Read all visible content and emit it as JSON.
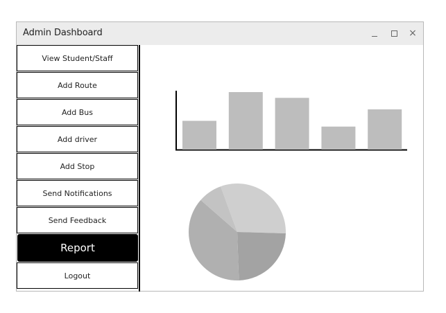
{
  "window": {
    "title": "Admin Dashboard",
    "controls": {
      "minimize_icon": "minimize-icon",
      "maximize_icon": "maximize-icon",
      "close_icon": "close-icon",
      "close_glyph": "×"
    }
  },
  "sidebar": {
    "items": [
      {
        "label": "View Student/Staff",
        "active": false
      },
      {
        "label": "Add Route",
        "active": false
      },
      {
        "label": "Add Bus",
        "active": false
      },
      {
        "label": "Add driver",
        "active": false
      },
      {
        "label": "Add Stop",
        "active": false
      },
      {
        "label": "Send Notifications",
        "active": false
      },
      {
        "label": "Send Feedback",
        "active": false
      },
      {
        "label": "Report",
        "active": true
      },
      {
        "label": "Logout",
        "active": false
      }
    ]
  },
  "colors": {
    "active_bg": "#000000",
    "bar_fill": "#bdbdbd",
    "pie_slices": [
      "#cfcfcf",
      "#a3a3a3",
      "#b0b0b0",
      "#c3c3c3"
    ]
  },
  "chart_data": [
    {
      "type": "bar",
      "values": [
        5,
        10,
        9,
        4,
        7
      ],
      "ylim": [
        0,
        10
      ],
      "grid": false
    },
    {
      "type": "pie",
      "values": [
        31,
        24,
        37,
        8
      ]
    }
  ]
}
